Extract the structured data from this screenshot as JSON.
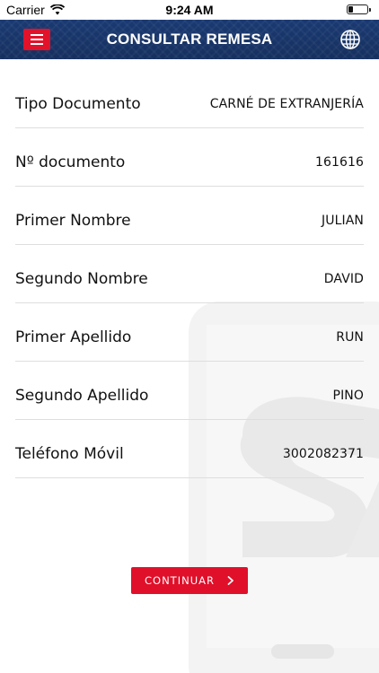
{
  "status_bar": {
    "carrier": "Carrier",
    "time": "9:24 AM",
    "icons": [
      "wifi-icon",
      "battery-icon"
    ]
  },
  "header": {
    "title": "CONSULTAR REMESA",
    "menu_icon": "hamburger-menu-icon",
    "language_icon": "globe-icon",
    "menu_color": "#e2122a",
    "background_color": "#1b3a73"
  },
  "form": {
    "rows": [
      {
        "label": "Tipo Documento",
        "value": "CARNÉ DE EXTRANJERÍA"
      },
      {
        "label": "Nº documento",
        "value": "161616"
      },
      {
        "label": "Primer Nombre",
        "value": "JULIAN"
      },
      {
        "label": "Segundo Nombre",
        "value": "DAVID"
      },
      {
        "label": "Primer Apellido",
        "value": "RUN"
      },
      {
        "label": "Segundo Apellido",
        "value": "PINO"
      },
      {
        "label": "Teléfono Móvil",
        "value": "3002082371"
      }
    ]
  },
  "actions": {
    "continue_label": "CONTINUAR",
    "continue_icon": "chevron-right-icon",
    "accent_color": "#e0102a"
  }
}
